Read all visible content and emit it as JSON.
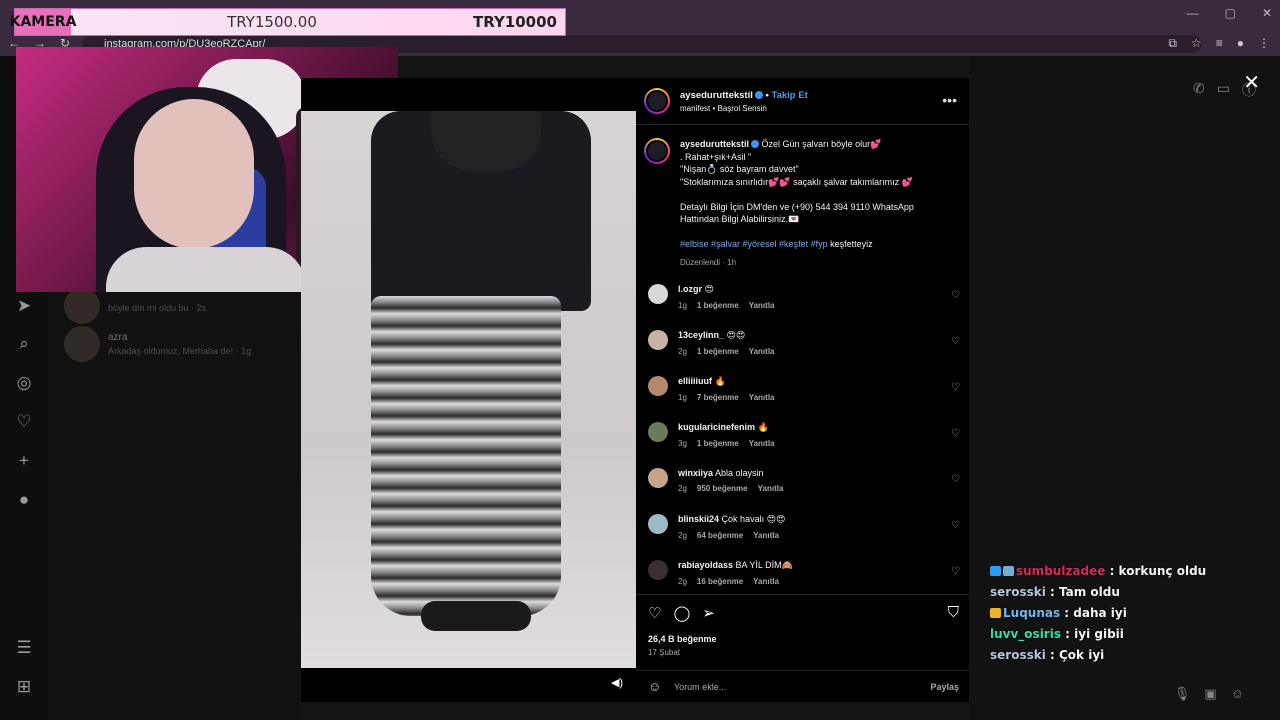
{
  "browser": {
    "url": "instagram.com/p/DU3eoRZCApr/"
  },
  "overlay": {
    "label": "KAMERA",
    "current": "TRY1500.00",
    "goal": "TRY10000"
  },
  "dm_list": [
    {
      "name": "",
      "message": "böyle dm mi oldu bu · 2s"
    },
    {
      "name": "azra",
      "message": "Arkadaş oldumuz, Merhaba de! · 1g"
    }
  ],
  "post": {
    "username": "aysedurutte­kstil",
    "follow_label": "Takip Et",
    "subtitle": "manifest • Başrol Sensin",
    "caption": {
      "user": "aysedurutte­kstil",
      "lines": [
        "Özel Gün şalvarı böyle olur💕",
        ". Rahat+şık+Asil \"",
        "\"Nişan💍 söz bayram davvet\"",
        "\"Stoklarımıza sınırlıdır💕💕 saçaklı şalvar takımlarımız 💕",
        "",
        "Detaylı Bilgi İçin DM'den ve (+90) 544 394 9110 WhatsApp",
        "Hattından Bilgi Alabilirsiniz.💌",
        ""
      ],
      "tags": "#elbise #şalvar #yöresel #keşfet #fyp",
      "tags_tail": "keşfetteyiz",
      "meta": "Düzenlendi · 1h"
    },
    "reply_label": "Yanıtla",
    "comments": [
      {
        "user": "l.ozgr",
        "text": "😍",
        "age": "1g",
        "likes": "1 beğenme",
        "avatar": "#d8d8d8"
      },
      {
        "user": "13ceylinn_",
        "text": "😍😍",
        "age": "2g",
        "likes": "1 beğenme",
        "avatar": "#c9b3a8"
      },
      {
        "user": "elliiiiuuf",
        "text": "🔥",
        "age": "1g",
        "likes": "7 beğenme",
        "avatar": "#b48a6a"
      },
      {
        "user": "kugularicinefenim",
        "text": "🔥",
        "age": "3g",
        "likes": "1 beğenme",
        "avatar": "#6a7a5a"
      },
      {
        "user": "winxiiya",
        "text": "Abla olaysin",
        "age": "2g",
        "likes": "950 beğenme",
        "avatar": "#c4a48a"
      },
      {
        "user": "blinskii24",
        "text": "Çok havalı 😍😍",
        "age": "2g",
        "likes": "64 beğenme",
        "avatar": "#a0b8c8"
      },
      {
        "user": "rabiayoldass",
        "text": "BA YİL DİM🙈",
        "age": "2g",
        "likes": "16 beğenme",
        "avatar": "#3a3030"
      }
    ],
    "likes_total": "26,4 B beğenme",
    "date": "17 Şubat",
    "comment_placeholder": "Yorum ekle...",
    "share_label": "Paylaş"
  },
  "chat": [
    {
      "user": "sumbulzadee",
      "text": ": korkunç oldu",
      "color": "#d9285c",
      "badges": [
        "#2a9df4",
        "#7ad"
      ]
    },
    {
      "user": "serosski",
      "text": ": Tam oldu",
      "color": "#b9c4dc",
      "badges": []
    },
    {
      "user": "Luqunas",
      "text": ": daha iyi",
      "color": "#6fb8f0",
      "badges": [
        "#f0b429"
      ]
    },
    {
      "user": "luvv_osiris",
      "text": ": iyi gibii",
      "color": "#2ee0b0",
      "badges": []
    },
    {
      "user": "serosski",
      "text": ": Çok iyi",
      "color": "#b9c4dc",
      "badges": []
    }
  ],
  "colors": {
    "follow": "#4a9ef3",
    "overlay_accent": "#e870b9"
  }
}
